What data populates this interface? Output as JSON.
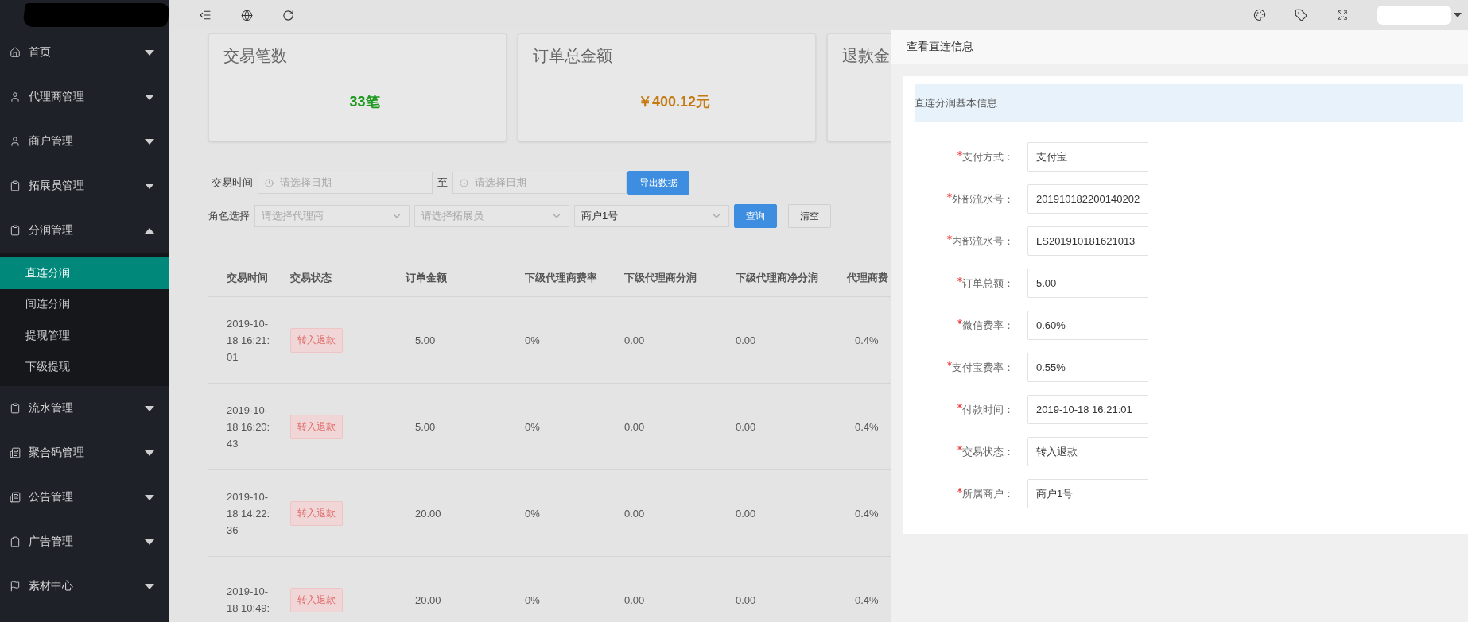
{
  "sidebar": {
    "items": [
      {
        "label": "首页",
        "kind": "home",
        "expanded": false
      },
      {
        "label": "代理商管理",
        "kind": "user",
        "expanded": false
      },
      {
        "label": "商户管理",
        "kind": "user",
        "expanded": false
      },
      {
        "label": "拓展员管理",
        "kind": "clipboard",
        "expanded": false
      },
      {
        "label": "分润管理",
        "kind": "clipboard",
        "expanded": true,
        "children": [
          {
            "label": "直连分润",
            "selected": true
          },
          {
            "label": "间连分润",
            "selected": false
          },
          {
            "label": "提现管理",
            "selected": false
          },
          {
            "label": "下级提现",
            "selected": false
          }
        ]
      },
      {
        "label": "流水管理",
        "kind": "clipboard",
        "expanded": false
      },
      {
        "label": "聚合码管理",
        "kind": "book",
        "expanded": false
      },
      {
        "label": "公告管理",
        "kind": "book",
        "expanded": false
      },
      {
        "label": "广告管理",
        "kind": "clipboard",
        "expanded": false
      },
      {
        "label": "素材中心",
        "kind": "flag",
        "expanded": false
      }
    ]
  },
  "cards": [
    {
      "title": "交易笔数",
      "value": "33笔",
      "color": "#1f9a1f"
    },
    {
      "title": "订单总金额",
      "value": "￥400.12元",
      "color": "#c47a12"
    },
    {
      "title": "退款金"
    }
  ],
  "filters": {
    "time_label": "交易时间",
    "start_placeholder": "请选择日期",
    "to_label": "至",
    "end_placeholder": "请选择日期",
    "export_button": "导出数据",
    "role_label": "角色选择",
    "agent_placeholder": "请选择代理商",
    "promoter_placeholder": "请选择拓展员",
    "merchant_value": "商户1号",
    "query_button": "查询",
    "clear_button": "清空"
  },
  "table": {
    "columns": [
      "交易时间",
      "交易状态",
      "订单金额",
      "下级代理商费率",
      "下级代理商分润",
      "下级代理商净分润",
      "代理商费"
    ],
    "rows": [
      {
        "time": "2019-10-18 16:21:01",
        "status": "转入退款",
        "amount": "5.00",
        "sub_rate": "0%",
        "sub_profit": "0.00",
        "sub_net_profit": "0.00",
        "agent_rate": "0.4%"
      },
      {
        "time": "2019-10-18 16:20:43",
        "status": "转入退款",
        "amount": "5.00",
        "sub_rate": "0%",
        "sub_profit": "0.00",
        "sub_net_profit": "0.00",
        "agent_rate": "0.4%"
      },
      {
        "time": "2019-10-18 14:22:36",
        "status": "转入退款",
        "amount": "20.00",
        "sub_rate": "0%",
        "sub_profit": "0.00",
        "sub_net_profit": "0.00",
        "agent_rate": "0.4%"
      },
      {
        "time": "2019-10-18 10:49:",
        "status": "转入退款",
        "amount": "20.00",
        "sub_rate": "0%",
        "sub_profit": "0.00",
        "sub_net_profit": "0.00",
        "agent_rate": "0.4%"
      }
    ]
  },
  "panel": {
    "title": "查看直连信息",
    "section_title": "直连分润基本信息",
    "fields": [
      {
        "label": "支付方式：",
        "value": "支付宝",
        "required": true
      },
      {
        "label": "外部流水号：",
        "value": "201910182200140202",
        "required": true
      },
      {
        "label": "内部流水号：",
        "value": "LS201910181621013",
        "required": true
      },
      {
        "label": "订单总额：",
        "value": "5.00",
        "required": true
      },
      {
        "label": "微信费率：",
        "value": "0.60%",
        "required": true
      },
      {
        "label": "支付宝费率：",
        "value": "0.55%",
        "required": true
      },
      {
        "label": "付款时间：",
        "value": "2019-10-18 16:21:01",
        "required": true
      },
      {
        "label": "交易状态：",
        "value": "转入退款",
        "required": true
      },
      {
        "label": "所属商户：",
        "value": "商户1号",
        "required": true
      }
    ]
  }
}
